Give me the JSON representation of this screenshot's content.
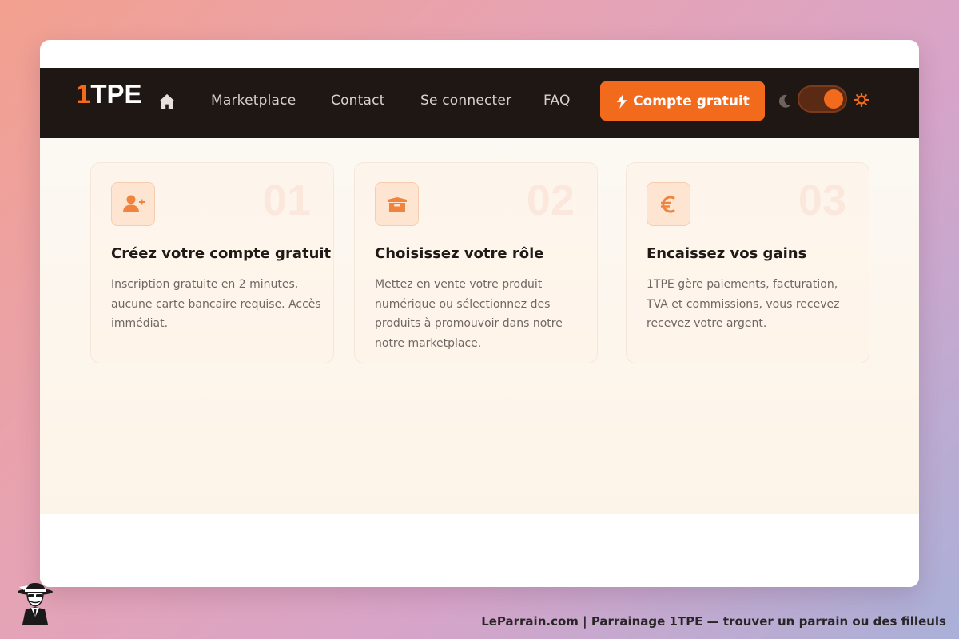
{
  "nav": {
    "logo_one": "1",
    "logo_rest": "TPE",
    "links": [
      "Marketplace",
      "Contact",
      "Se connecter",
      "FAQ"
    ],
    "cta_label": "Compte gratuit",
    "theme_toggle": "dark-mode-toggle"
  },
  "cards": [
    {
      "number": "01",
      "icon": "user-plus-icon",
      "title": "Créez votre compte gratuit",
      "text": "Inscription gratuite en 2 minutes, aucune carte bancaire requise. Accès immédiat."
    },
    {
      "number": "02",
      "icon": "box-icon",
      "title": "Choisissez votre rôle",
      "text": "Mettez en vente votre produit numérique ou sélectionnez des produits à promouvoir dans notre notre marketplace."
    },
    {
      "number": "03",
      "icon": "euro-icon",
      "title": "Encaissez vos gains",
      "text": "1TPE gère paiements, facturation, TVA et commissions, vous recevez recevez votre argent."
    }
  ],
  "footer": {
    "text": "LeParrain.com | Parrainage 1TPE — trouver un parrain ou des filleuls"
  },
  "colors": {
    "accent": "#f26b1d",
    "navbar": "#1e1714"
  }
}
